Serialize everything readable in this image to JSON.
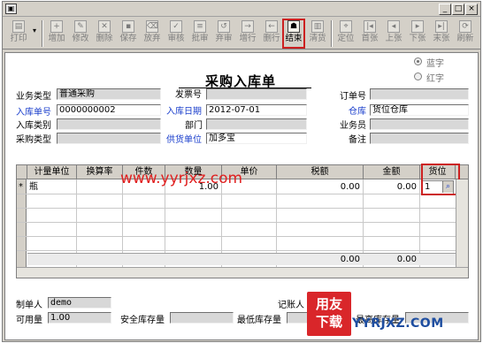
{
  "window": {
    "app_icon": "app-icon",
    "minimize": "_",
    "maximize": "□",
    "close": "×"
  },
  "toolbar": {
    "print": "打印",
    "add": "增加",
    "edit": "修改",
    "delete": "删除",
    "save": "保存",
    "abandon": "放弃",
    "audit": "审核",
    "reject": "批审",
    "reject2": "弃审",
    "add_row": "增行",
    "del_row": "删行",
    "finish": "结束",
    "clear": "清货",
    "locate": "定位",
    "first": "首张",
    "prev": "上张",
    "next": "下张",
    "last": "末张",
    "refresh": "刷新"
  },
  "form": {
    "title": "采购入库单",
    "radio_blue": "蓝字",
    "radio_red": "红字",
    "business_type_label": "业务类型",
    "business_type_value": "普通采购",
    "invoice_no_label": "发票号",
    "invoice_no_value": "",
    "order_no_label": "订单号",
    "order_no_value": "",
    "receipt_no_label": "入库单号",
    "receipt_no_value": "0000000002",
    "receipt_date_label": "入库日期",
    "receipt_date_value": "2012-07-01",
    "warehouse_label": "仓库",
    "warehouse_value": "货位仓库",
    "receipt_category_label": "入库类别",
    "receipt_category_value": "",
    "department_label": "部门",
    "department_value": "",
    "salesman_label": "业务员",
    "salesman_value": "",
    "purchase_type_label": "采购类型",
    "purchase_type_value": "",
    "supplier_label": "供货单位",
    "supplier_value": "加多宝",
    "remark_label": "备注",
    "remark_value": ""
  },
  "grid": {
    "columns": [
      "计量单位",
      "换算率",
      "件数",
      "数量",
      "单价",
      "税额",
      "金额",
      "货位"
    ],
    "rows": [
      {
        "marker": "*",
        "unit": "瓶",
        "rate": "",
        "pieces": "",
        "quantity": "1.00",
        "price": "",
        "tax": "0.00",
        "amount": "0.00",
        "location": "1"
      }
    ],
    "totals": {
      "tax": "0.00",
      "amount": "0.00"
    }
  },
  "footer": {
    "maker_label": "制单人",
    "maker_value": "demo",
    "bookkeeper_label": "记账人",
    "bookkeeper_value": "",
    "available_label": "可用量",
    "available_value": "1.00",
    "safety_stock_label": "安全库存量",
    "safety_stock_value": "",
    "min_stock_label": "最低库存量",
    "min_stock_value": "",
    "max_stock_label": "最高库存量",
    "max_stock_value": ""
  },
  "watermark": "www.yyrjxz.com",
  "logo": {
    "line1": "用友",
    "line2": "下载",
    "site": "YYRJXZ.COM"
  },
  "colors": {
    "label_blue": "#1a3ecc",
    "highlight_red": "#cc2020",
    "watermark_red": "#e02020"
  }
}
